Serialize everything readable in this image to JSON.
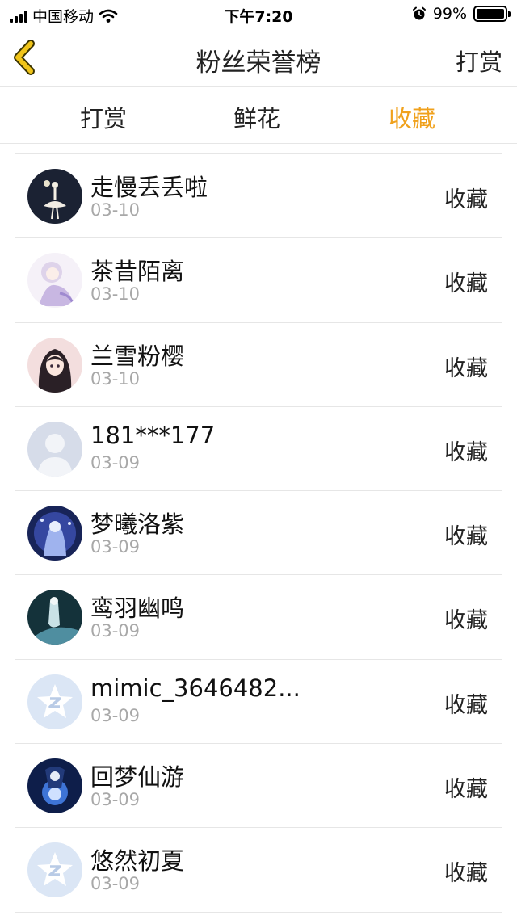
{
  "status_bar": {
    "carrier": "中国移动",
    "time": "下午7:20",
    "battery": "99%",
    "battery_level": 0.99,
    "icons": [
      "signal-icon",
      "wifi-icon",
      "alarm-icon",
      "battery-icon"
    ]
  },
  "nav": {
    "title": "粉丝荣誉榜",
    "right_label": "打赏",
    "back_icon": "chevron-left-icon",
    "accent_color": "#f0c419"
  },
  "tabs": [
    {
      "label": "打赏",
      "active": false
    },
    {
      "label": "鲜花",
      "active": false
    },
    {
      "label": "收藏",
      "active": true
    }
  ],
  "active_tab_color": "#f0a11c",
  "fans": [
    {
      "name": "走慢丢丢啦",
      "date": "03-10",
      "action": "收藏",
      "avatar": "photo-dark-dancer"
    },
    {
      "name": "茶昔陌离",
      "date": "03-10",
      "action": "收藏",
      "avatar": "photo-anime-lavender"
    },
    {
      "name": "兰雪粉樱",
      "date": "03-10",
      "action": "收藏",
      "avatar": "photo-anime-girl"
    },
    {
      "name": "181***177",
      "date": "03-09",
      "action": "收藏",
      "avatar": "default-person"
    },
    {
      "name": "梦曦洛紫",
      "date": "03-09",
      "action": "收藏",
      "avatar": "photo-blue-fantasy"
    },
    {
      "name": "鸾羽幽鸣",
      "date": "03-09",
      "action": "收藏",
      "avatar": "photo-teal-fantasy"
    },
    {
      "name": "mimic_3646482...",
      "date": "03-09",
      "action": "收藏",
      "avatar": "default-star"
    },
    {
      "name": "回梦仙游",
      "date": "03-09",
      "action": "收藏",
      "avatar": "photo-blue-glow"
    },
    {
      "name": "悠然初夏",
      "date": "03-09",
      "action": "收藏",
      "avatar": "default-star"
    }
  ]
}
